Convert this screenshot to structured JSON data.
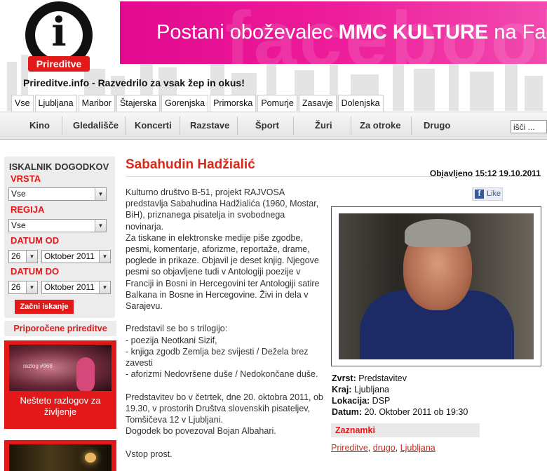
{
  "logo": {
    "glyph": "i",
    "badge": "Prireditve"
  },
  "banner": {
    "ghost": "facebook",
    "prefix": "Postani oboževalec ",
    "bold": "MMC KULTURE",
    "suffix": " na Faceb"
  },
  "tagline": "Prireditve.info - Razvedrilo za vsak žep in okus!",
  "region_tabs": [
    "Vse",
    "Ljubljana",
    "Maribor",
    "Štajerska",
    "Gorenjska",
    "Primorska",
    "Pomurje",
    "Zasavje",
    "Dolenjska"
  ],
  "main_nav": [
    "Kino",
    "Gledališče",
    "Koncerti",
    "Razstave",
    "Šport",
    "Žuri",
    "Za otroke",
    "Drugo"
  ],
  "search": {
    "value": "išči ..."
  },
  "finder": {
    "title": "ISKALNIK DOGODKOV",
    "type_label": "VRSTA",
    "type_value": "Vse",
    "region_label": "REGIJA",
    "region_value": "Vse",
    "from_label": "DATUM OD",
    "from_day": "26",
    "from_month": "Oktober 2011",
    "to_label": "DATUM DO",
    "to_day": "26",
    "to_month": "Oktober 2011",
    "button": "Začni iskanje"
  },
  "recommended": {
    "header": "Priporočene prireditve",
    "card1_image_text": "razlog #968",
    "card1_caption": "Nešteto razlogov za življenje"
  },
  "article": {
    "title": "Sabahudin Hadžialić",
    "published": "Objavljeno 15:12 19.10.2011",
    "like": "Like",
    "paragraphs": [
      "Kulturno društvo B-51, projekt RAJVOSA predstavlja Sabahudina Hadžialića (1960, Mostar, BiH), priznanega pisatelja in svobodnega novinarja.\nZa tiskane in elektronske medije piše zgodbe, pesmi, komentarje, aforizme, reportaže, drame, poglede in prikaze. Objavil je deset knjig. Njegove pesmi so objavljene tudi v Antologiji poezije v Franciji in Bosni in Hercegovini ter Antologiji satire Balkana in Bosne in Hercegovine. Živi in dela v Sarajevu.",
      "Predstavil se bo s trilogijo:\n- poezija Neotkani Sizif,\n- knjiga zgodb Zemlja bez svijesti / Dežela brez zavesti\n- aforizmi Nedovršene duše / Nedokončane duše.",
      "Predstavitev bo v četrtek, dne 20. oktobra 2011, ob 19.30, v prostorih Društva slovenskih pisateljev, Tomšičeva 12 v Ljubljani.\nDogodek bo povezoval Bojan Albahari.",
      "Vstop prost."
    ],
    "info": {
      "type_label": "Zvrst:",
      "type_value": " Predstavitev",
      "place_label": "Kraj:",
      "place_value": " Ljubljana",
      "location_label": "Lokacija:",
      "location_value": " DSP",
      "date_label": "Datum:",
      "date_value": " 20. Oktober 2011 ob 19:30"
    },
    "tags_header": "Zaznamki",
    "tags": [
      "Prireditve",
      "drugo",
      "Ljubljana"
    ]
  }
}
